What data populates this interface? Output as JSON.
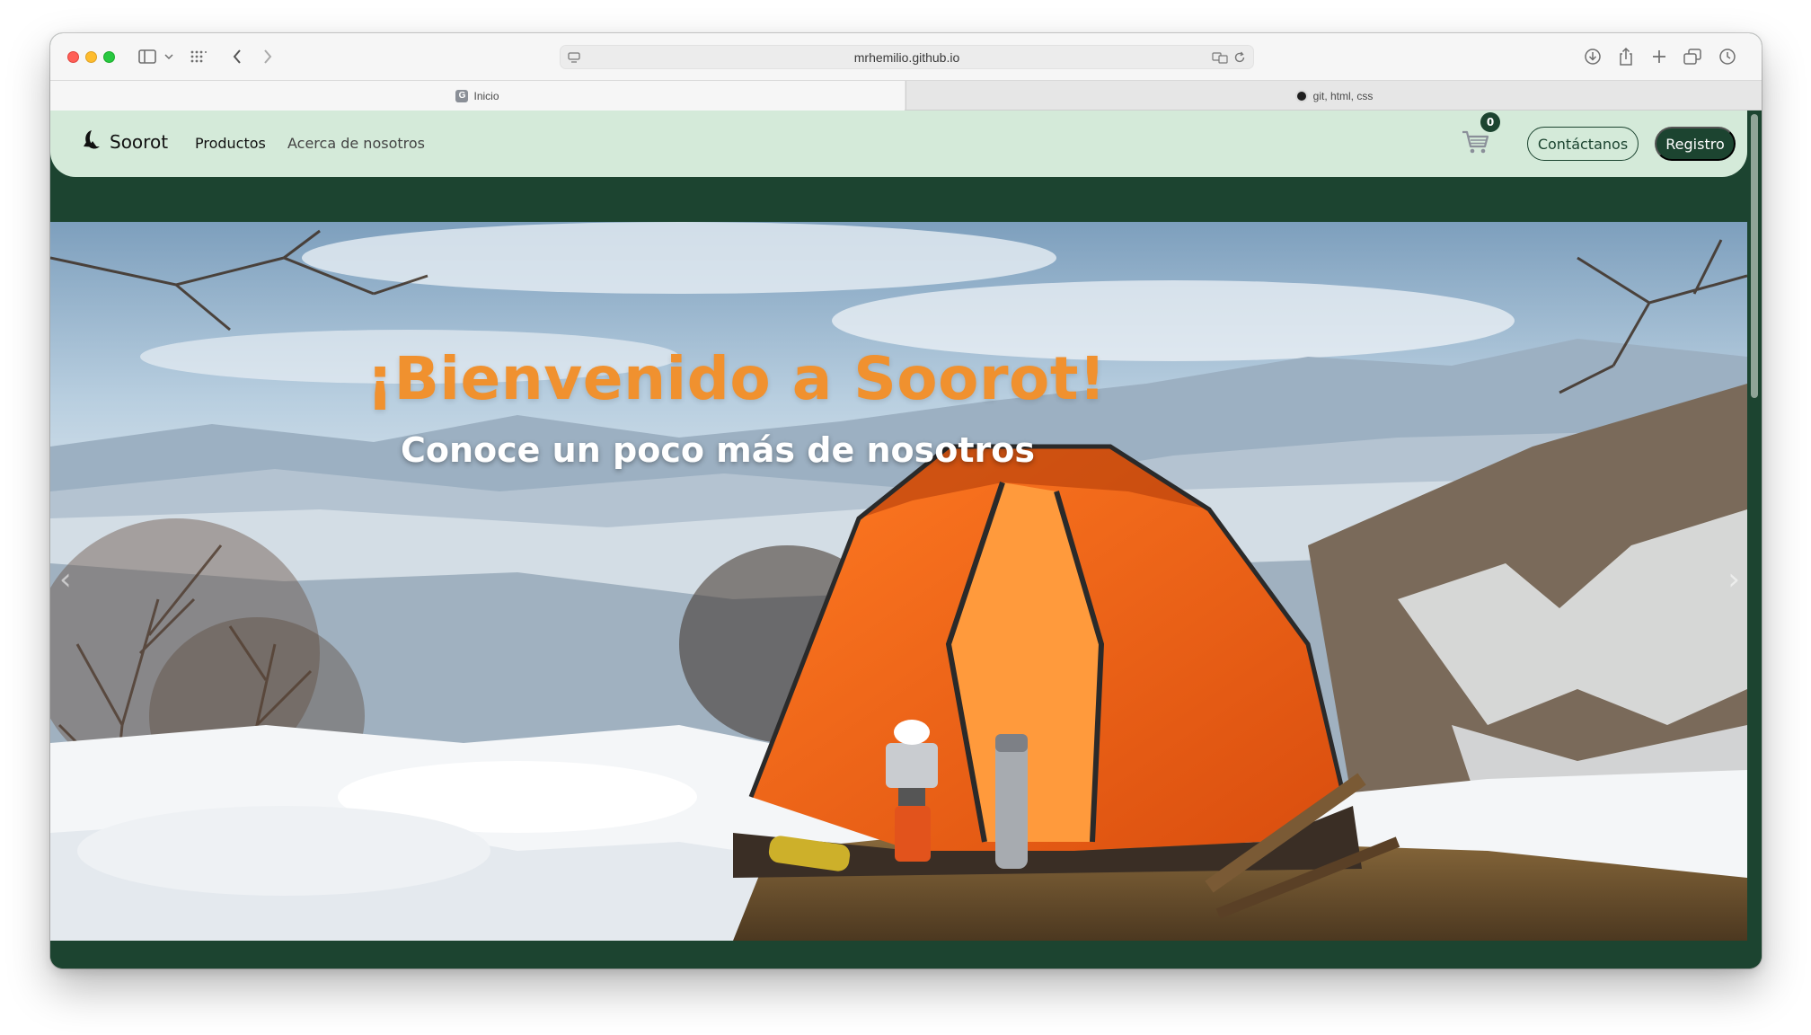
{
  "browser": {
    "url": "mrhemilio.github.io",
    "tabs": [
      {
        "label": "Inicio",
        "favicon": "github-pages-icon"
      },
      {
        "label": "git, html, css",
        "favicon": "github-icon"
      }
    ]
  },
  "navbar": {
    "brand": "Soorot",
    "links": [
      "Productos",
      "Acerca de nosotros"
    ],
    "cart_count": "0",
    "contact_label": "Contáctanos",
    "register_label": "Registro"
  },
  "hero": {
    "title": "¡Bienvenido a Soorot!",
    "subtitle": "Conoce un poco más de nosotros",
    "prev_icon": "chevron-left-icon",
    "next_icon": "chevron-right-icon"
  },
  "colors": {
    "primary_dark": "#1c4430",
    "navbar_bg": "#d4ead9",
    "hero_title": "#f0912f",
    "tent": "#f26a1b"
  }
}
